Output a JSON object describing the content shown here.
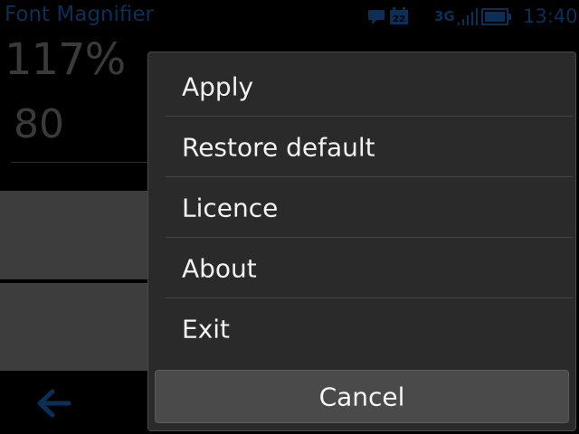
{
  "status_bar": {
    "app_title": "Font Magnifier",
    "network": "3G",
    "clock": "13:40",
    "calendar_day": "22",
    "icons": [
      "chat-notification-icon",
      "calendar-icon",
      "signal-strength-icon",
      "battery-icon"
    ],
    "icon_color": "#0c2f57"
  },
  "app": {
    "zoom_percent": "117%",
    "size_value": "80",
    "back_icon": "back-arrow-icon"
  },
  "menu": {
    "items": [
      {
        "label": "Apply"
      },
      {
        "label": "Restore default"
      },
      {
        "label": "Licence"
      },
      {
        "label": "About"
      },
      {
        "label": "Exit"
      }
    ],
    "cancel_label": "Cancel"
  }
}
